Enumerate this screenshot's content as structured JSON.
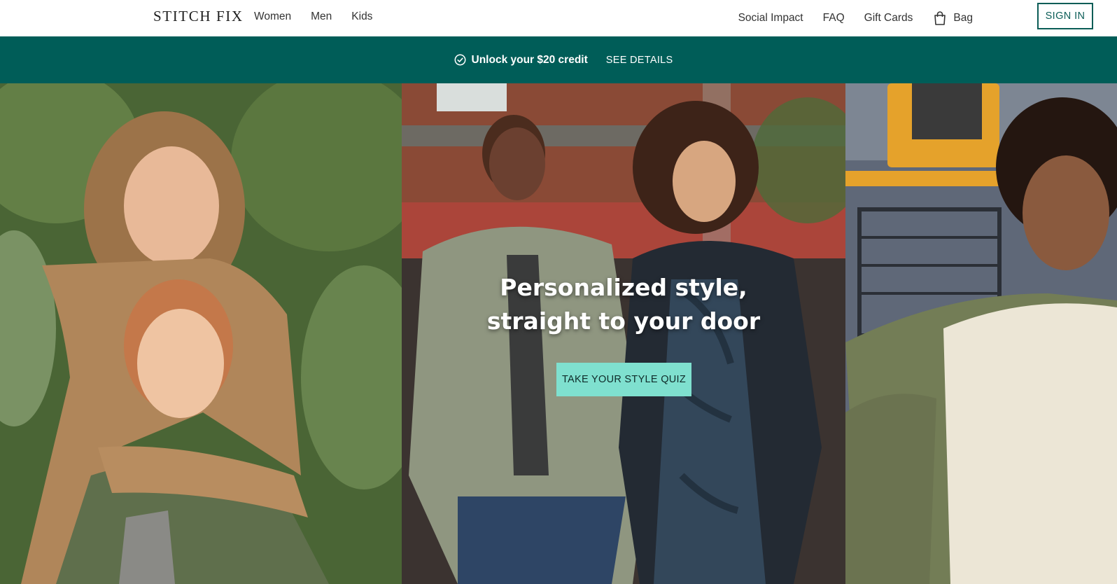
{
  "header": {
    "logo": "STITCH FIX",
    "nav_left": [
      "Women",
      "Men",
      "Kids"
    ],
    "nav_right": [
      "Social Impact",
      "FAQ",
      "Gift Cards"
    ],
    "bag_label": "Bag",
    "signin_label": "SIGN IN"
  },
  "promo": {
    "text": "Unlock your $20 credit",
    "link": "SEE DETAILS",
    "background": "#005d58"
  },
  "hero": {
    "title_line1": "Personalized style,",
    "title_line2": "straight to your door",
    "cta_label": "TAKE YOUR STYLE QUIZ",
    "cta_color": "#7fe0cf"
  },
  "colors": {
    "brand": "#005d58",
    "accent": "#7fe0cf"
  },
  "icons": {
    "bag": "shopping-bag-icon",
    "promo": "check-circle-icon"
  }
}
